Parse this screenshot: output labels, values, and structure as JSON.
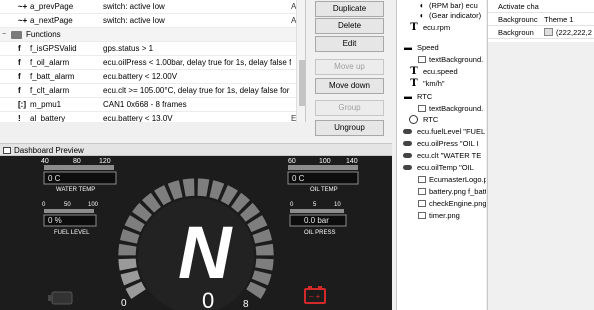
{
  "left_list": {
    "rows": [
      {
        "icon": "~+",
        "name": "a_prevPage",
        "value": "switch: active low",
        "flag": "A"
      },
      {
        "icon": "~+",
        "name": "a_nextPage",
        "value": "switch: active low",
        "flag": "A"
      },
      {
        "group": true,
        "name": "Functions"
      },
      {
        "icon": "f",
        "name": "f_isGPSValid",
        "value": "gps.status > 1",
        "flag": ""
      },
      {
        "icon": "f",
        "name": "f_oil_alarm",
        "value": "ecu.oilPress < 1.00bar, delay true for 1s, delay false for 1s",
        "flag": ""
      },
      {
        "icon": "f",
        "name": "f_batt_alarm",
        "value": "ecu.battery < 12.00V",
        "flag": ""
      },
      {
        "icon": "f",
        "name": "f_clt_alarm",
        "value": "ecu.clt >= 105.00°C, delay true for 1s, delay false for 1s",
        "flag": ""
      },
      {
        "icon": "[:]",
        "name": "m_pmu1",
        "value": "CAN1 0x668 - 8 frames",
        "flag": ""
      },
      {
        "icon": "!",
        "name": "al_battery",
        "value": "ecu.battery < 13.0V",
        "flag": "E"
      }
    ]
  },
  "buttons": {
    "duplicate": "Duplicate",
    "delete": "Delete",
    "edit": "Edit",
    "move_up": "Move up",
    "move_down": "Move down",
    "group": "Group",
    "ungroup": "Ungroup"
  },
  "tree": {
    "rows": [
      {
        "icon": "gauge",
        "text": "(RPM bar)  ecu"
      },
      {
        "icon": "gauge",
        "text": "(Gear indicator)"
      },
      {
        "icon": "T",
        "text": "ecu.rpm"
      },
      {
        "icon": "folder",
        "text": "Speed"
      },
      {
        "icon": "img",
        "text": "textBackground."
      },
      {
        "icon": "T",
        "text": "ecu.speed"
      },
      {
        "icon": "T",
        "text": "\"km/h\""
      },
      {
        "icon": "folder",
        "text": "RTC"
      },
      {
        "icon": "img",
        "text": "textBackground."
      },
      {
        "icon": "clock",
        "text": "RTC"
      },
      {
        "icon": "toggle",
        "text": "ecu.fuelLevel   \"FUEL"
      },
      {
        "icon": "toggle",
        "text": "ecu.oilPress   \"OIL I"
      },
      {
        "icon": "toggle",
        "text": "ecu.clt   \"WATER TE"
      },
      {
        "icon": "toggle",
        "text": "ecu.oilTemp   \"OIL"
      },
      {
        "icon": "img",
        "text": "EcumasterLogo.png"
      },
      {
        "icon": "img",
        "text": "battery.png   f_batt"
      },
      {
        "icon": "img",
        "text": "checkEngine.png"
      },
      {
        "icon": "img",
        "text": "timer.png"
      }
    ]
  },
  "props": {
    "rows": [
      {
        "name": "Activate cha",
        "value": ""
      },
      {
        "name": "Backgrounc",
        "value": "Theme 1"
      },
      {
        "name": "Backgroun",
        "value": "(222,222,2",
        "swatch": "#dedede"
      }
    ]
  },
  "dash_panel": {
    "title": "Dashboard Preview"
  },
  "dashboard": {
    "water_temp": {
      "ticks": [
        "40",
        "80",
        "120"
      ],
      "value": "0 C",
      "label": "WATER TEMP"
    },
    "fuel_level": {
      "ticks": [
        "0",
        "50",
        "100"
      ],
      "value": "0 %",
      "label": "FUEL LEVEL"
    },
    "oil_temp": {
      "ticks": [
        "60",
        "100",
        "140"
      ],
      "value": "0 C",
      "label": "OIL TEMP"
    },
    "oil_press": {
      "ticks": [
        "0",
        "5",
        "10"
      ],
      "value": "0.0 bar",
      "label": "OIL PRESS"
    },
    "gear": "N",
    "speed": "0",
    "rpm_ticks": [
      "0",
      "8"
    ],
    "colors": {
      "accent_red": "#d22a2a",
      "gauge_gray": "#8c8c8c",
      "panel_bg": "#1c1c1c"
    }
  }
}
